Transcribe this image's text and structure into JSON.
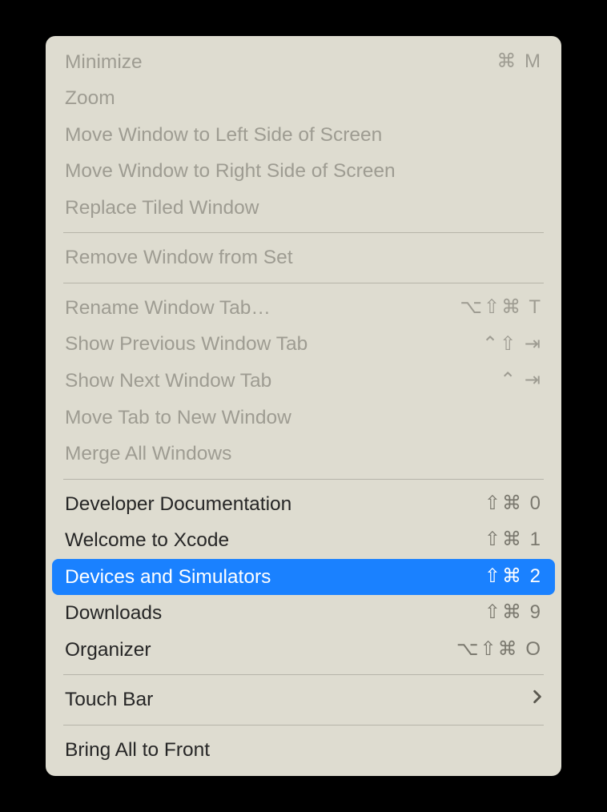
{
  "menu": {
    "sections": [
      {
        "items": [
          {
            "label": "Minimize",
            "shortcut": "⌘ M",
            "enabled": false
          },
          {
            "label": "Zoom",
            "shortcut": "",
            "enabled": false
          },
          {
            "label": "Move Window to Left Side of Screen",
            "shortcut": "",
            "enabled": false
          },
          {
            "label": "Move Window to Right Side of Screen",
            "shortcut": "",
            "enabled": false
          },
          {
            "label": "Replace Tiled Window",
            "shortcut": "",
            "enabled": false
          }
        ]
      },
      {
        "items": [
          {
            "label": "Remove Window from Set",
            "shortcut": "",
            "enabled": false
          }
        ]
      },
      {
        "items": [
          {
            "label": "Rename Window Tab…",
            "shortcut": "⌥⇧⌘ T",
            "enabled": false
          },
          {
            "label": "Show Previous Window Tab",
            "shortcut": "⌃⇧ ⇥",
            "enabled": false
          },
          {
            "label": "Show Next Window Tab",
            "shortcut": "⌃ ⇥",
            "enabled": false
          },
          {
            "label": "Move Tab to New Window",
            "shortcut": "",
            "enabled": false
          },
          {
            "label": "Merge All Windows",
            "shortcut": "",
            "enabled": false
          }
        ]
      },
      {
        "items": [
          {
            "label": "Developer Documentation",
            "shortcut": "⇧⌘ 0",
            "enabled": true
          },
          {
            "label": "Welcome to Xcode",
            "shortcut": "⇧⌘ 1",
            "enabled": true
          },
          {
            "label": "Devices and Simulators",
            "shortcut": "⇧⌘ 2",
            "enabled": true,
            "selected": true
          },
          {
            "label": "Downloads",
            "shortcut": "⇧⌘ 9",
            "enabled": true
          },
          {
            "label": "Organizer",
            "shortcut": "⌥⇧⌘ O",
            "enabled": true
          }
        ]
      },
      {
        "items": [
          {
            "label": "Touch Bar",
            "shortcut": "",
            "enabled": true,
            "submenu": true
          }
        ]
      },
      {
        "items": [
          {
            "label": "Bring All to Front",
            "shortcut": "",
            "enabled": true
          }
        ]
      }
    ]
  }
}
